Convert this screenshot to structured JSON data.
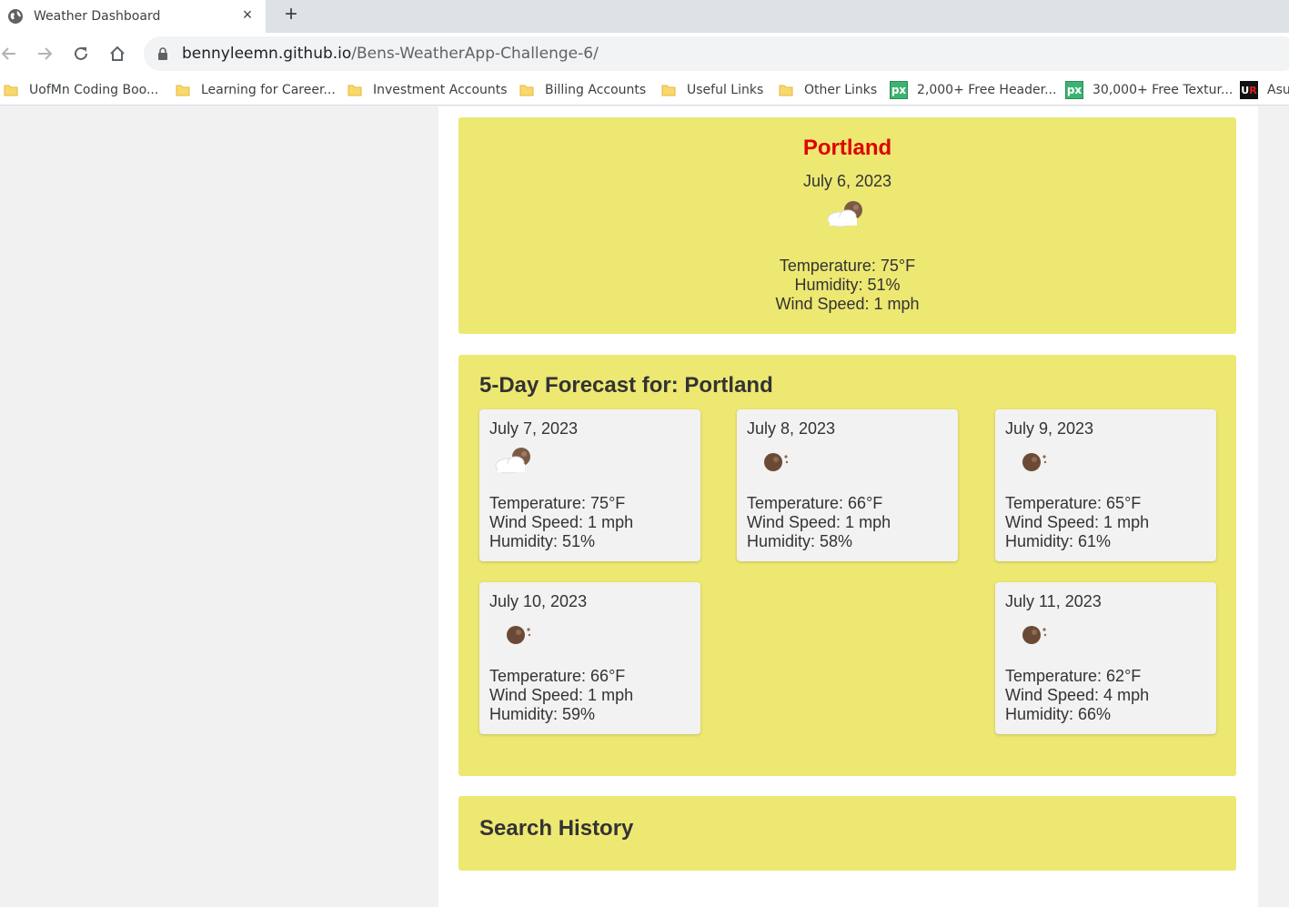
{
  "browser": {
    "tab_title": "Weather Dashboard",
    "tab_close": "×",
    "new_tab": "+",
    "url_domain": "bennyleemn.github.io",
    "url_path": "/Bens-WeatherApp-Challenge-6/",
    "bookmarks": [
      {
        "label": "UofMn Coding Boo...",
        "icon": "folder-icon"
      },
      {
        "label": "Learning for Career...",
        "icon": "folder-icon"
      },
      {
        "label": "Investment Accounts",
        "icon": "folder-icon"
      },
      {
        "label": "Billing Accounts",
        "icon": "folder-icon"
      },
      {
        "label": "Useful Links",
        "icon": "folder-icon"
      },
      {
        "label": "Other Links",
        "icon": "folder-icon"
      },
      {
        "label": "2,000+ Free Header...",
        "icon": "px-icon",
        "icon_text": "px"
      },
      {
        "label": "30,000+ Free Textur...",
        "icon": "px-icon",
        "icon_text": "px"
      },
      {
        "label": "Asu",
        "icon": "ur-icon",
        "icon_text": "UR"
      }
    ]
  },
  "current": {
    "city": "Portland",
    "date": "July 6, 2023",
    "icon": "partly-cloudy-night-icon",
    "temperature": "Temperature: 75°F",
    "humidity": "Humidity: 51%",
    "wind": "Wind Speed: 1 mph"
  },
  "forecast": {
    "title": "5-Day Forecast for: Portland",
    "days": [
      {
        "date": "July 7, 2023",
        "icon": "partly-cloudy-night-icon",
        "temperature": "Temperature: 75°F",
        "wind": "Wind Speed: 1 mph",
        "humidity": "Humidity: 51%"
      },
      {
        "date": "July 8, 2023",
        "icon": "clear-night-icon",
        "temperature": "Temperature: 66°F",
        "wind": "Wind Speed: 1 mph",
        "humidity": "Humidity: 58%"
      },
      {
        "date": "July 9, 2023",
        "icon": "clear-night-icon",
        "temperature": "Temperature: 65°F",
        "wind": "Wind Speed: 1 mph",
        "humidity": "Humidity: 61%"
      },
      {
        "date": "July 10, 2023",
        "icon": "clear-night-icon",
        "temperature": "Temperature: 66°F",
        "wind": "Wind Speed: 1 mph",
        "humidity": "Humidity: 59%"
      },
      {
        "date": "July 11, 2023",
        "icon": "clear-night-icon",
        "temperature": "Temperature: 62°F",
        "wind": "Wind Speed: 4 mph",
        "humidity": "Humidity: 66%"
      }
    ]
  },
  "history": {
    "title": "Search History"
  },
  "colors": {
    "panel": "#ede872",
    "city": "#e00000",
    "card": "#f2f2f2"
  }
}
